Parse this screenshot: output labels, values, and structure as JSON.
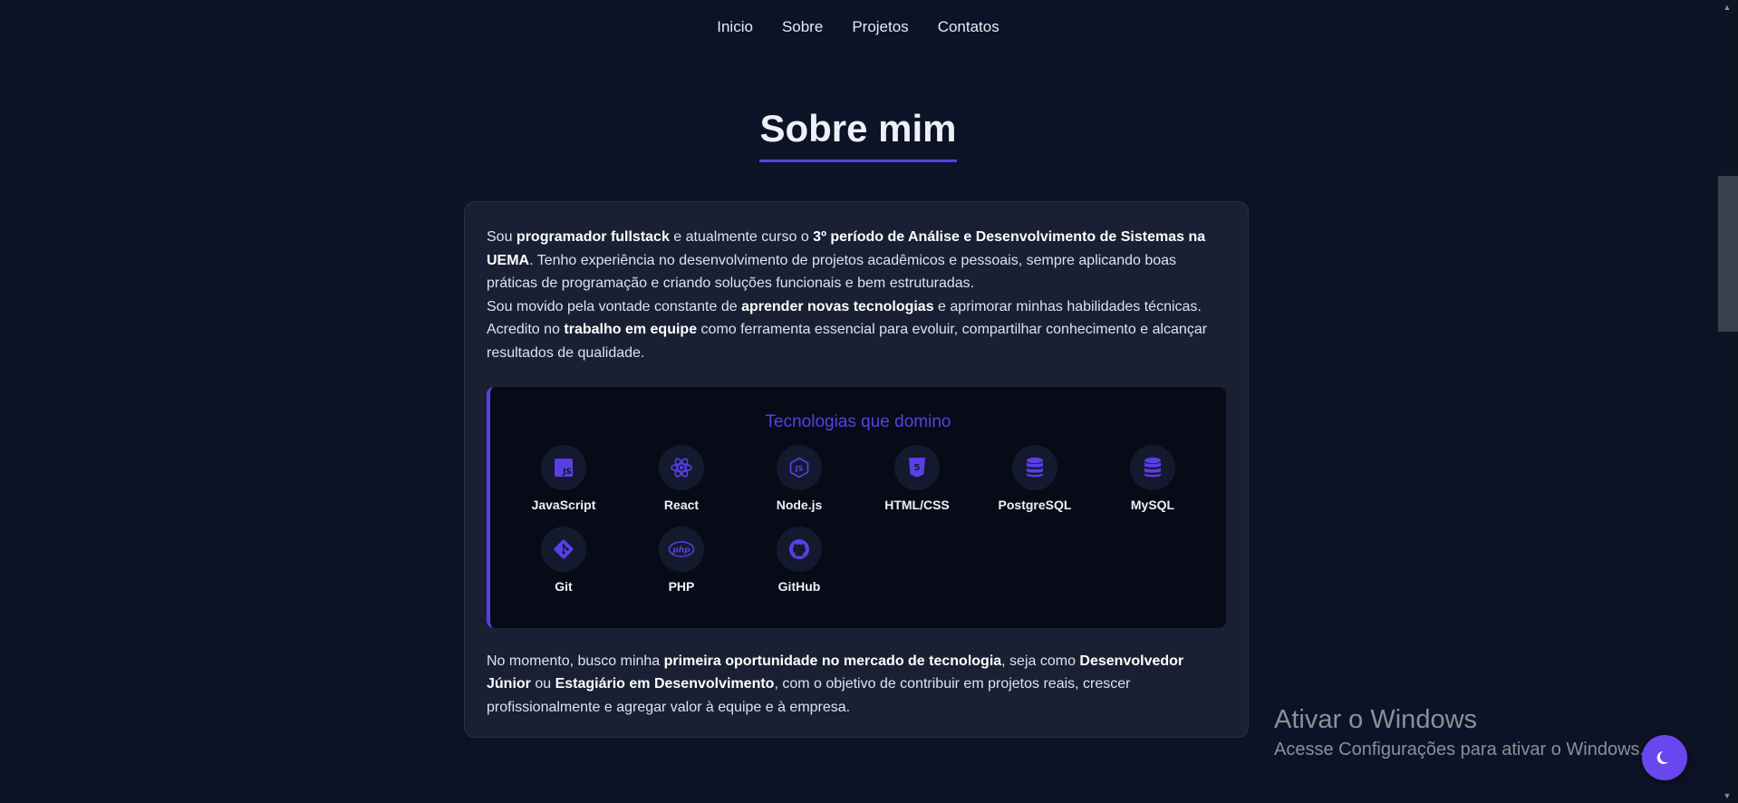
{
  "nav": {
    "items": [
      {
        "label": "Inicio"
      },
      {
        "label": "Sobre"
      },
      {
        "label": "Projetos"
      },
      {
        "label": "Contatos"
      }
    ]
  },
  "section": {
    "title": "Sobre mim"
  },
  "about": {
    "p1": [
      {
        "t": "Sou ",
        "b": false
      },
      {
        "t": "programador fullstack",
        "b": true
      },
      {
        "t": " e atualmente curso o ",
        "b": false
      },
      {
        "t": "3º período de Análise e Desenvolvimento de Sistemas na UEMA",
        "b": true
      },
      {
        "t": ". Tenho experiência no desenvolvimento de projetos acadêmicos e pessoais, sempre aplicando boas práticas de programação e criando soluções funcionais e bem estruturadas.",
        "b": false
      }
    ],
    "p2": [
      {
        "t": "Sou movido pela vontade constante de ",
        "b": false
      },
      {
        "t": "aprender novas tecnologias",
        "b": true
      },
      {
        "t": " e aprimorar minhas habilidades técnicas. Acredito no ",
        "b": false
      },
      {
        "t": "trabalho em equipe",
        "b": true
      },
      {
        "t": " como ferramenta essencial para evoluir, compartilhar conhecimento e alcançar resultados de qualidade.",
        "b": false
      }
    ],
    "p3": [
      {
        "t": "No momento, busco minha ",
        "b": false
      },
      {
        "t": "primeira oportunidade no mercado de tecnologia",
        "b": true
      },
      {
        "t": ", seja como ",
        "b": false
      },
      {
        "t": "Desenvolvedor Júnior",
        "b": true
      },
      {
        "t": " ou ",
        "b": false
      },
      {
        "t": "Estagiário em Desenvolvimento",
        "b": true
      },
      {
        "t": ", com o objetivo de contribuir em projetos reais, crescer profissionalmente e agregar valor à equipe e à empresa.",
        "b": false
      }
    ]
  },
  "tech": {
    "title": "Tecnologias que domino",
    "items": [
      {
        "label": "JavaScript",
        "icon": "javascript-icon"
      },
      {
        "label": "React",
        "icon": "react-icon"
      },
      {
        "label": "Node.js",
        "icon": "nodejs-icon"
      },
      {
        "label": "HTML/CSS",
        "icon": "html5-icon"
      },
      {
        "label": "PostgreSQL",
        "icon": "database-icon"
      },
      {
        "label": "MySQL",
        "icon": "database-icon"
      },
      {
        "label": "Git",
        "icon": "git-icon"
      },
      {
        "label": "PHP",
        "icon": "php-icon"
      },
      {
        "label": "GitHub",
        "icon": "github-icon"
      }
    ]
  },
  "watermark": {
    "line1": "Ativar o Windows",
    "line2": "Acesse Configurações para ativar o Windows."
  },
  "theme_toggle": {
    "icon": "moon-icon"
  },
  "colors": {
    "accent": "#5b3ee6",
    "background": "#0d1326",
    "card": "#1a2033"
  }
}
